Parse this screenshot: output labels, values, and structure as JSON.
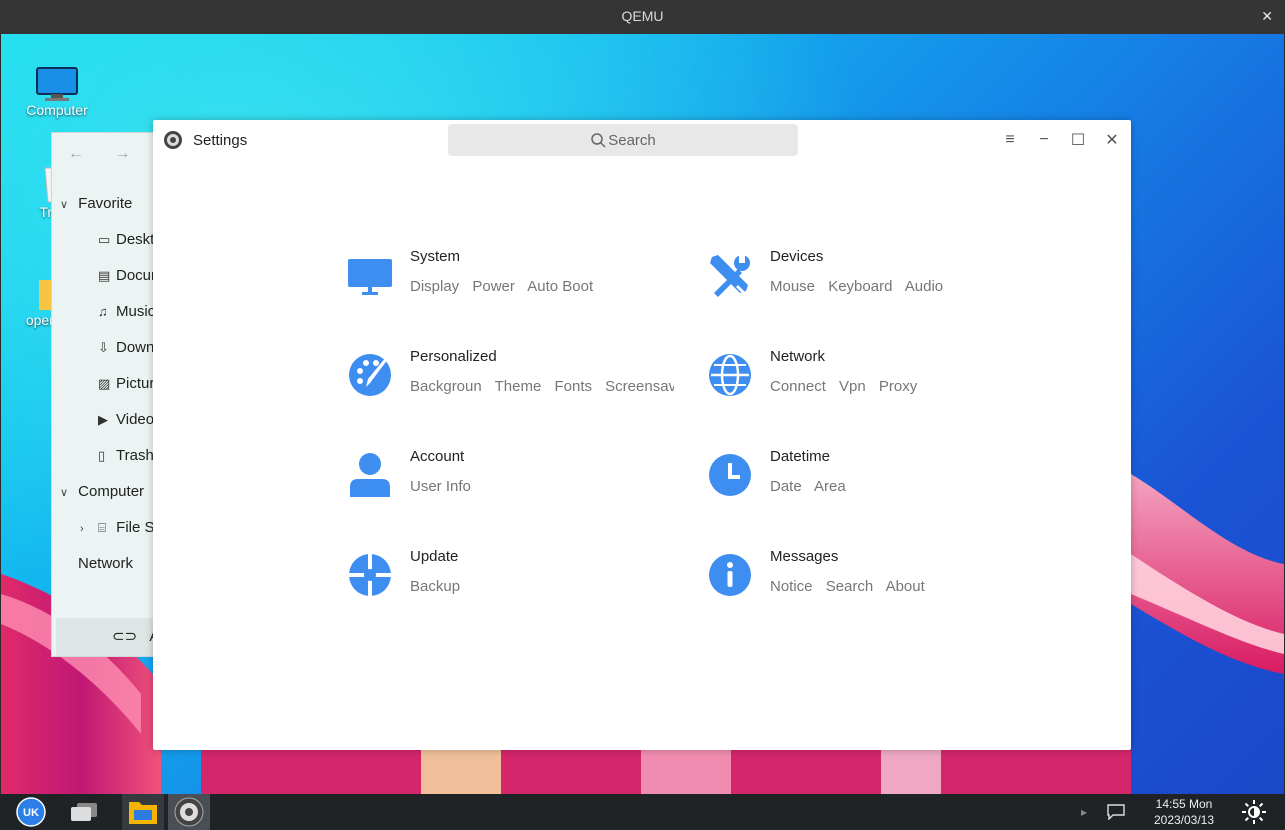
{
  "qemu": {
    "title": "QEMU",
    "close": "✕"
  },
  "desktop": {
    "icons": [
      {
        "label": "Computer",
        "icon": "monitor-icon"
      },
      {
        "label": "Trash",
        "icon": "trash-icon"
      },
      {
        "label": "openeuler",
        "icon": "folder-icon"
      }
    ]
  },
  "file_manager": {
    "nav_back": "←",
    "nav_forward": "→",
    "sections": [
      {
        "label": "Favorite",
        "items": [
          {
            "label": "Desktop",
            "icon": "desktop-icon"
          },
          {
            "label": "Documents",
            "icon": "document-icon"
          },
          {
            "label": "Music",
            "icon": "music-icon"
          },
          {
            "label": "Downloads",
            "icon": "download-icon"
          },
          {
            "label": "Pictures",
            "icon": "picture-icon"
          },
          {
            "label": "Videos",
            "icon": "video-icon"
          },
          {
            "label": "Trash",
            "icon": "trash-icon"
          }
        ]
      },
      {
        "label": "Computer",
        "items": [
          {
            "label": "File System",
            "icon": "drive-icon"
          }
        ]
      },
      {
        "label": "Network",
        "items": []
      }
    ],
    "bottom_label": "All"
  },
  "settings": {
    "title": "Settings",
    "search_placeholder": "Search",
    "categories": [
      {
        "title": "System",
        "icon": "monitor-icon",
        "subs": [
          "Display",
          "Power",
          "Auto Boot"
        ]
      },
      {
        "title": "Devices",
        "icon": "tools-icon",
        "subs": [
          "Mouse",
          "Keyboard",
          "Audio"
        ]
      },
      {
        "title": "Personalized",
        "icon": "palette-icon",
        "subs": [
          "Backgroun",
          "Theme",
          "Fonts",
          "Screensave"
        ]
      },
      {
        "title": "Network",
        "icon": "globe-icon",
        "subs": [
          "Connect",
          "Vpn",
          "Proxy"
        ]
      },
      {
        "title": "Account",
        "icon": "user-icon",
        "subs": [
          "User Info"
        ]
      },
      {
        "title": "Datetime",
        "icon": "clock-icon",
        "subs": [
          "Date",
          "Area"
        ]
      },
      {
        "title": "Update",
        "icon": "update-icon",
        "subs": [
          "Backup"
        ]
      },
      {
        "title": "Messages",
        "icon": "info-icon",
        "subs": [
          "Notice",
          "Search",
          "About"
        ]
      }
    ],
    "accent": "#3d8ef0"
  },
  "taskbar": {
    "clock_time": "14:55 Mon",
    "clock_date": "2023/03/13"
  }
}
